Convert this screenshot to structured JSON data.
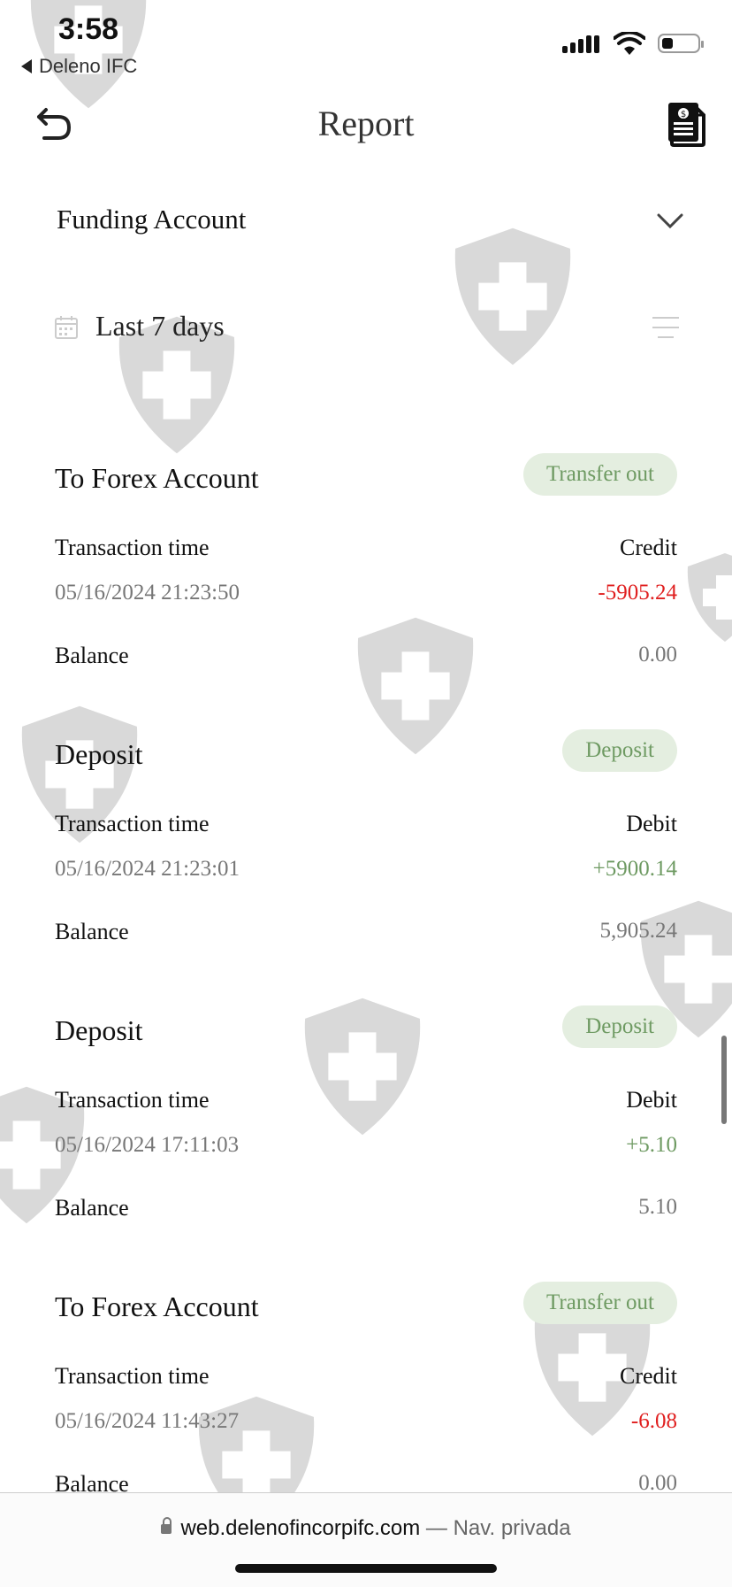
{
  "status": {
    "time": "3:58",
    "back_app": "Deleno IFC"
  },
  "header": {
    "title": "Report"
  },
  "account_selector": {
    "label": "Funding Account"
  },
  "date_range": {
    "label": "Last 7 days"
  },
  "transactions": [
    {
      "title": "To Forex Account",
      "badge": "Transfer out",
      "time_label": "Transaction time",
      "type_label": "Credit",
      "datetime": "05/16/2024 21:23:50",
      "amount": "-5905.24",
      "balance_label": "Balance",
      "balance": "0.00"
    },
    {
      "title": "Deposit",
      "badge": "Deposit",
      "time_label": "Transaction time",
      "type_label": "Debit",
      "datetime": "05/16/2024 21:23:01",
      "amount": "+5900.14",
      "balance_label": "Balance",
      "balance": "5,905.24"
    },
    {
      "title": "Deposit",
      "badge": "Deposit",
      "time_label": "Transaction time",
      "type_label": "Debit",
      "datetime": "05/16/2024 17:11:03",
      "amount": "+5.10",
      "balance_label": "Balance",
      "balance": "5.10"
    },
    {
      "title": "To Forex Account",
      "badge": "Transfer out",
      "time_label": "Transaction time",
      "type_label": "Credit",
      "datetime": "05/16/2024 11:43:27",
      "amount": "-6.08",
      "balance_label": "Balance",
      "balance": "0.00"
    }
  ],
  "browser": {
    "domain": "web.delenofincorpifc.com",
    "mode": "— Nav. privada"
  },
  "colors": {
    "credit": "#e02020",
    "debit": "#6e9a62",
    "badge_bg": "#e4eee0"
  }
}
